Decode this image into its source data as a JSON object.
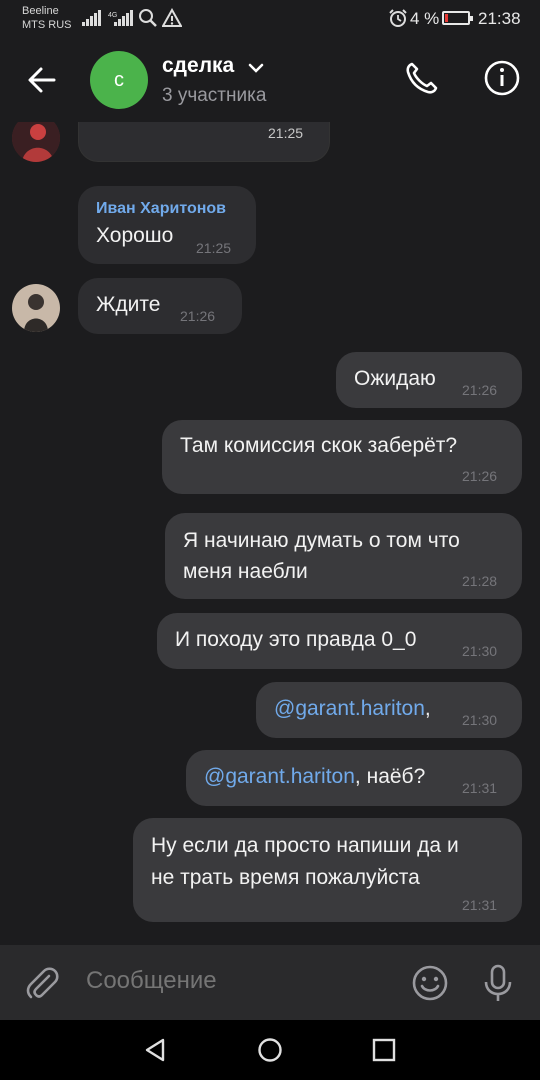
{
  "status_bar": {
    "carrier_line1": "Beeline",
    "carrier_line2": "MTS RUS",
    "battery_percent": "4 %",
    "time": "21:38"
  },
  "header": {
    "avatar_letter": "с",
    "title": "сделка",
    "subtitle": "3 участника"
  },
  "messages": [
    {
      "time": "21:25"
    },
    {
      "sender": "Иван Харитонов",
      "text": "Хорошо",
      "time": "21:25"
    },
    {
      "text": "Ждите",
      "time": "21:26"
    },
    {
      "text": "Ожидаю",
      "time": "21:26"
    },
    {
      "text": "Там комиссия скок заберёт?",
      "time": "21:26"
    },
    {
      "line1": "Я начинаю думать о том что",
      "line2": "меня наебли",
      "time": "21:28"
    },
    {
      "text": "И походу это правда 0_0",
      "time": "21:30"
    },
    {
      "mention": "@garant.hariton",
      "suffix": ",",
      "time": "21:30"
    },
    {
      "mention": "@garant.hariton",
      "suffix": ", наёб?",
      "time": "21:31"
    },
    {
      "line1": "Ну если да просто напиши да и",
      "line2": "не трать время пожалуйста",
      "time": "21:31"
    }
  ],
  "composer": {
    "placeholder": "Сообщение"
  },
  "icons": {
    "back": "arrow-left-icon",
    "call": "phone-icon",
    "info": "info-icon",
    "attach": "paperclip-icon",
    "emoji": "smile-icon",
    "voice": "microphone-icon"
  },
  "colors": {
    "background": "#1c1c1e",
    "bubble_in": "#2d2d30",
    "bubble_out": "#3a3a3d",
    "accent": "#71aaeb",
    "avatar_green": "#4bb34b"
  }
}
